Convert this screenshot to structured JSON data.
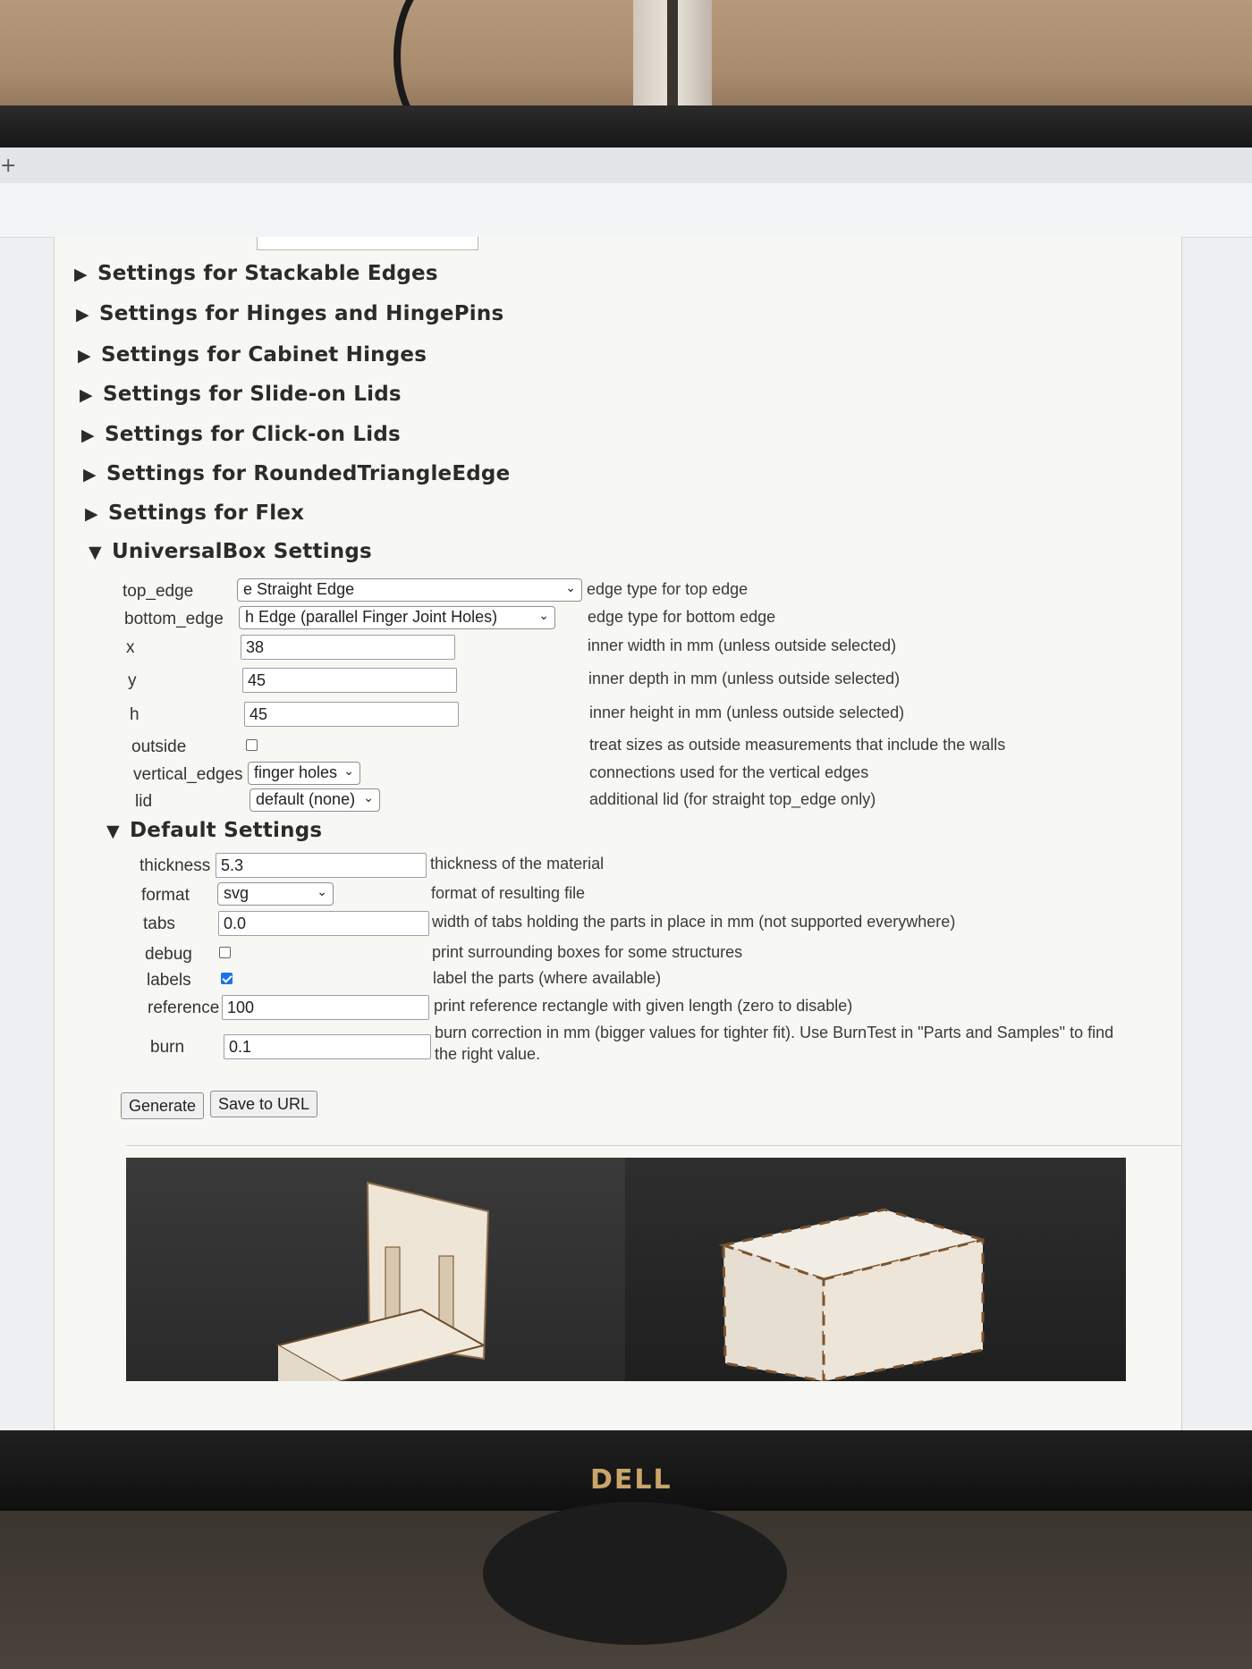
{
  "sections_collapsed": [
    "Settings for Stackable Edges",
    "Settings for Hinges and HingePins",
    "Settings for Cabinet Hinges",
    "Settings for Slide-on Lids",
    "Settings for Click-on Lids",
    "Settings for RoundedTriangleEdge",
    "Settings for Flex"
  ],
  "universal": {
    "title": "UniversalBox Settings",
    "top_edge": {
      "label": "top_edge",
      "value": "e Straight Edge",
      "desc": "edge type for top edge"
    },
    "bottom_edge": {
      "label": "bottom_edge",
      "value": "h Edge (parallel Finger Joint Holes)",
      "desc": "edge type for bottom edge"
    },
    "x": {
      "label": "x",
      "value": "38",
      "desc": "inner width in mm (unless outside selected)"
    },
    "y": {
      "label": "y",
      "value": "45",
      "desc": "inner depth in mm (unless outside selected)"
    },
    "h": {
      "label": "h",
      "value": "45",
      "desc": "inner height in mm (unless outside selected)"
    },
    "outside": {
      "label": "outside",
      "checked": false,
      "desc": "treat sizes as outside measurements that include the walls"
    },
    "vertical_edges": {
      "label": "vertical_edges",
      "value": "finger holes",
      "desc": "connections used for the vertical edges"
    },
    "lid": {
      "label": "lid",
      "value": "default (none)",
      "desc": "additional lid (for straight top_edge only)"
    }
  },
  "defaults": {
    "title": "Default Settings",
    "thickness": {
      "label": "thickness",
      "value": "5.3",
      "desc": "thickness of the material"
    },
    "format": {
      "label": "format",
      "value": "svg",
      "desc": "format of resulting file"
    },
    "tabs": {
      "label": "tabs",
      "value": "0.0",
      "desc": "width of tabs holding the parts in place in mm (not supported everywhere)"
    },
    "debug": {
      "label": "debug",
      "checked": false,
      "desc": "print surrounding boxes for some structures"
    },
    "labels": {
      "label": "labels",
      "checked": true,
      "desc": "label the parts (where available)"
    },
    "reference": {
      "label": "reference",
      "value": "100",
      "desc": "print reference rectangle with given length (zero to disable)"
    },
    "burn": {
      "label": "burn",
      "value": "0.1",
      "desc_line1": "burn correction in mm (bigger values for tighter fit). Use BurnTest in \"Parts and Samples\" to find",
      "desc_line2": "the right value."
    }
  },
  "buttons": {
    "generate": "Generate",
    "save_url": "Save to URL"
  },
  "monitor": {
    "brand": "DELL"
  },
  "colors": {
    "checkbox_on": "#1a73e8",
    "logo": "#c9a56b"
  }
}
